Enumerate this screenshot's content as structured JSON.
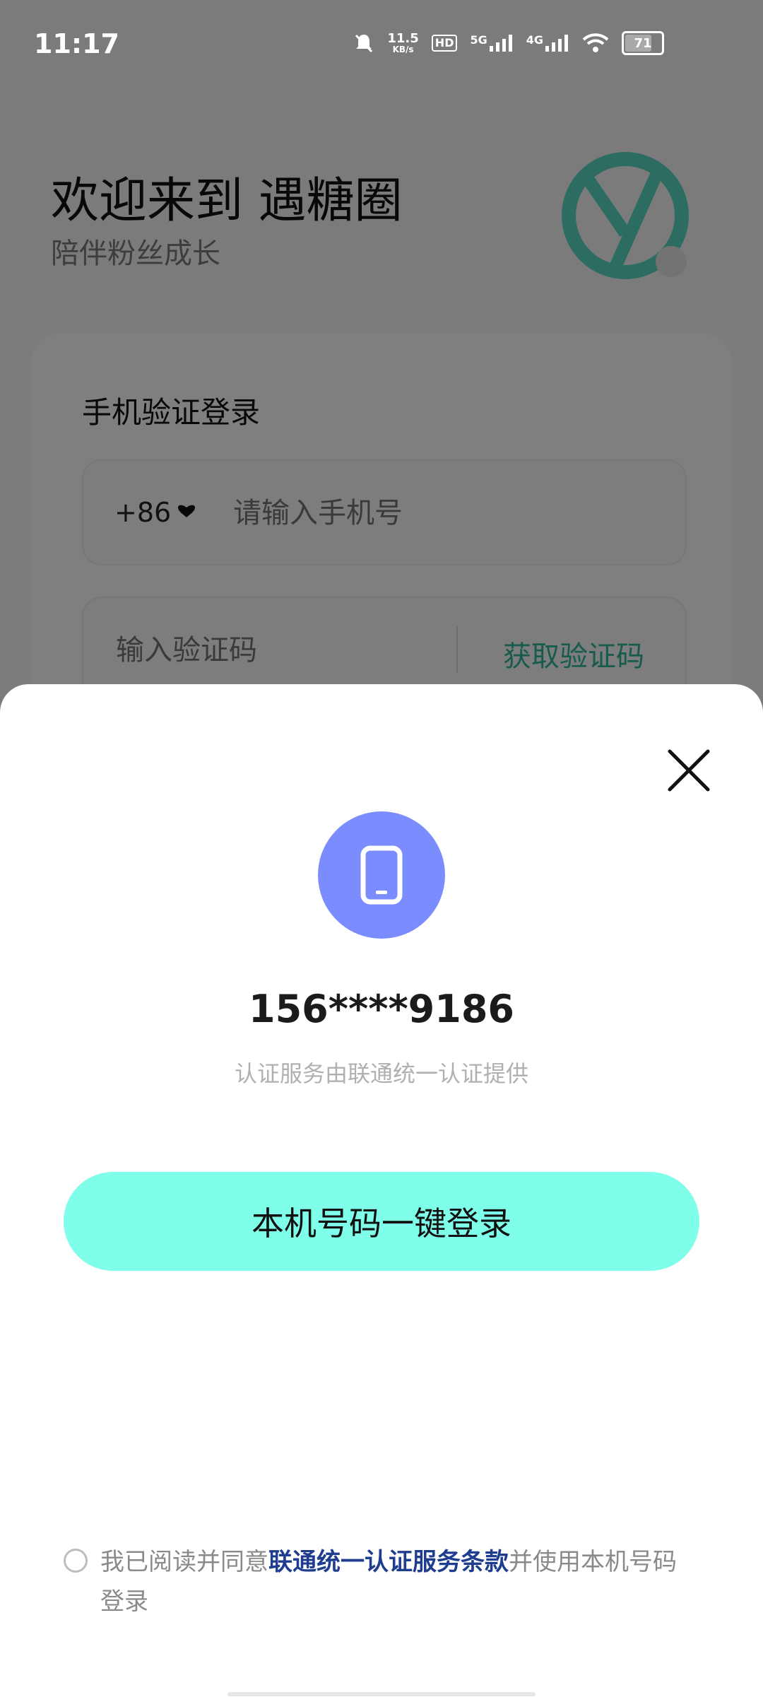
{
  "status_bar": {
    "time": "11:17",
    "net_speed_value": "11.5",
    "net_speed_unit": "KB/s",
    "hd_label": "HD",
    "sim1_network": "5G",
    "sim2_network": "4G",
    "battery_level": "71"
  },
  "welcome": {
    "title": "欢迎来到 遇糖圈",
    "subtitle": "陪伴粉丝成长"
  },
  "login_card": {
    "title": "手机验证登录",
    "country_code": "+86",
    "phone_placeholder": "请输入手机号",
    "code_placeholder": "输入验证码",
    "get_code_label": "获取验证码"
  },
  "sheet": {
    "masked_number": "156****9186",
    "auth_provider": "认证服务由联通统一认证提供",
    "one_click_label": "本机号码一键登录",
    "agreement": {
      "prefix": "我已阅读并同意",
      "link": "联通统一认证服务条款",
      "suffix": "并使用本机号码登录"
    }
  },
  "colors": {
    "accent_teal": "#7ffeea",
    "phone_circle": "#7b8cff",
    "link": "#1e3d8f",
    "get_code": "#2fb79b"
  },
  "icons": [
    "close-icon",
    "phone-icon",
    "chevron-down-icon",
    "wifi-icon",
    "signal-icon",
    "battery-icon",
    "mute-icon",
    "app-logo"
  ]
}
